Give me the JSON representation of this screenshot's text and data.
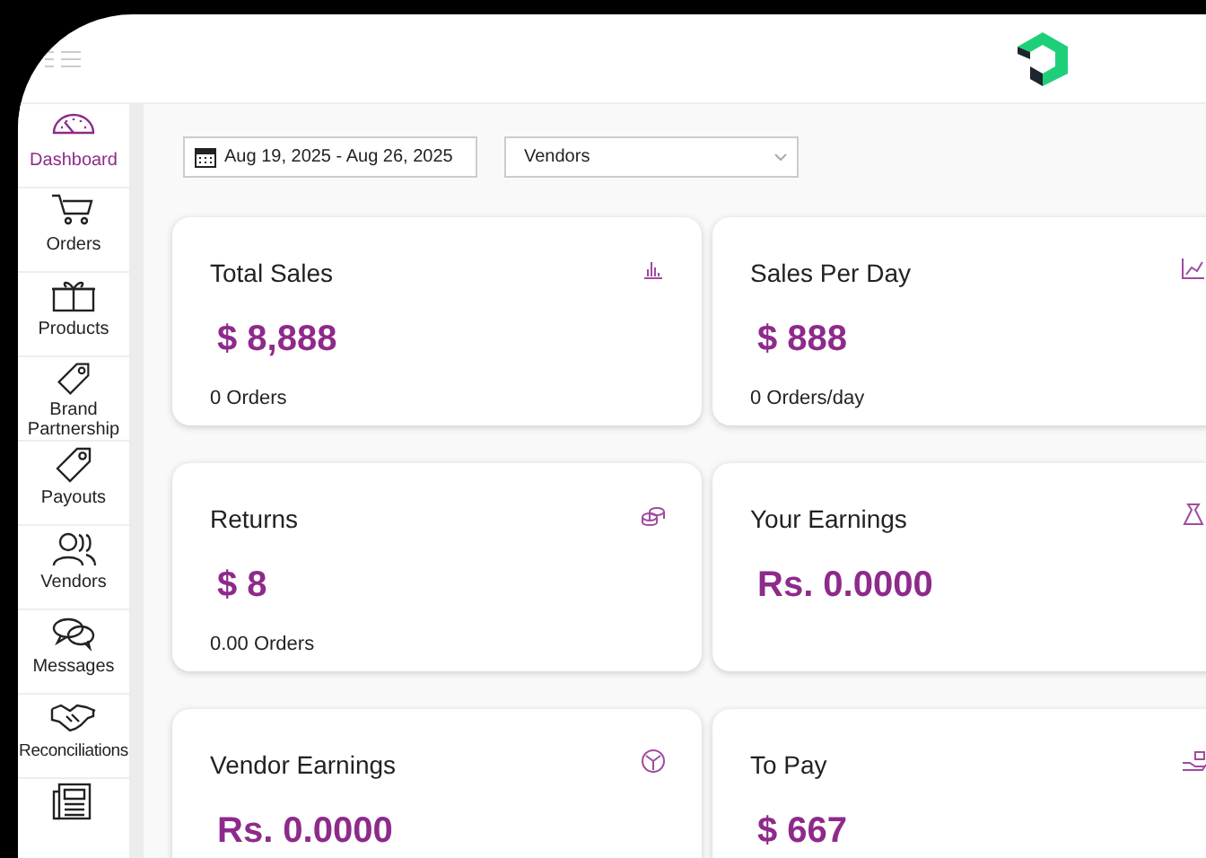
{
  "filters": {
    "date_range": "Aug 19, 2025 - Aug 26, 2025",
    "vendor_select": "Vendors"
  },
  "sidebar": {
    "items": [
      {
        "label": "Dashboard",
        "selected": true
      },
      {
        "label": "Orders",
        "selected": false
      },
      {
        "label": "Products",
        "selected": false
      },
      {
        "label": "Brand Partnership",
        "selected": false
      },
      {
        "label": "Payouts",
        "selected": false
      },
      {
        "label": "Vendors",
        "selected": false
      },
      {
        "label": "Messages",
        "selected": false
      },
      {
        "label": "Reconciliations",
        "selected": false
      },
      {
        "selected": false
      }
    ]
  },
  "cards": [
    {
      "title": "Total Sales",
      "value": "$ 8,888",
      "note": "0 Orders"
    },
    {
      "title": "Sales Per Day",
      "value": "$ 888",
      "note": "0 Orders/day"
    },
    {
      "title": "Returns",
      "value": "$ 8",
      "note": "0.00 Orders"
    },
    {
      "title": "Your Earnings",
      "value": "Rs. 0.0000"
    },
    {
      "title": "Vendor Earnings",
      "value": "Rs. 0.0000"
    },
    {
      "title": "To Pay",
      "value": "$ 667"
    }
  ]
}
